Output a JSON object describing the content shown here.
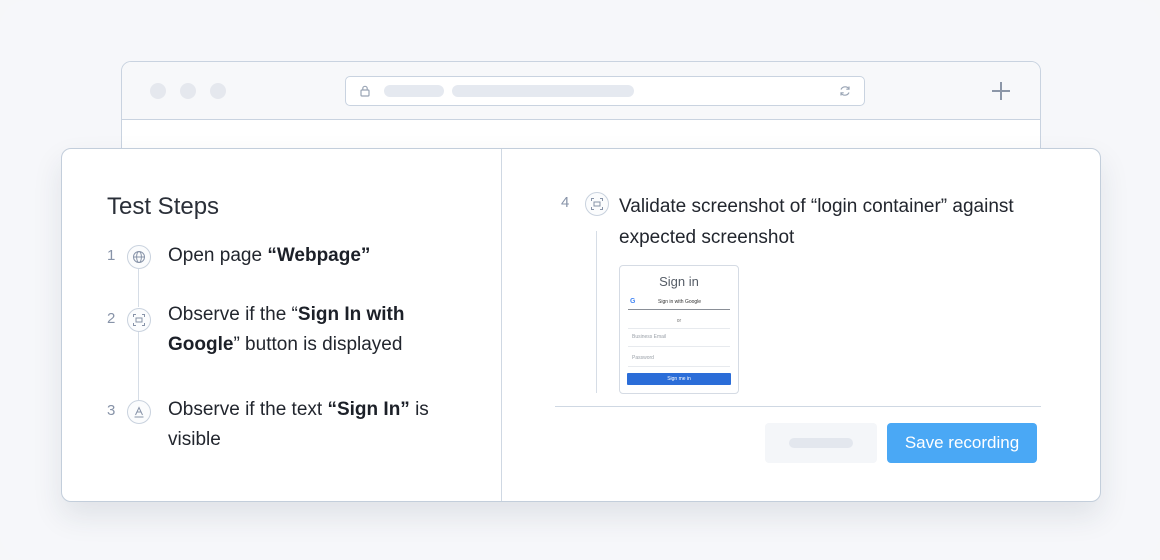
{
  "test_steps": {
    "title": "Test Steps",
    "steps": [
      {
        "number": "1",
        "icon": "globe-icon",
        "prefix": "Open page ",
        "bold": "“Webpage”",
        "suffix": ""
      },
      {
        "number": "2",
        "icon": "screenshot-frame-icon",
        "prefix": "Observe if the “",
        "bold": "Sign In with Google",
        "suffix": "” button is displayed"
      },
      {
        "number": "3",
        "icon": "text-a-icon",
        "prefix": "Observe if the text ",
        "bold": "“Sign In”",
        "suffix": " is visible"
      }
    ]
  },
  "validation_step": {
    "number": "4",
    "icon": "screenshot-frame-icon",
    "text": "Validate screenshot of “login container” against expected screenshot"
  },
  "thumbnail": {
    "title": "Sign in",
    "google_button": "Sign in with Google",
    "google_glyph": "G",
    "or": "or",
    "email_placeholder": "Business Email",
    "password_placeholder": "Password",
    "submit": "Sign me in"
  },
  "actions": {
    "save_label": "Save recording"
  },
  "colors": {
    "primary": "#4aa8f5",
    "thumb_button": "#2b6dd8"
  }
}
